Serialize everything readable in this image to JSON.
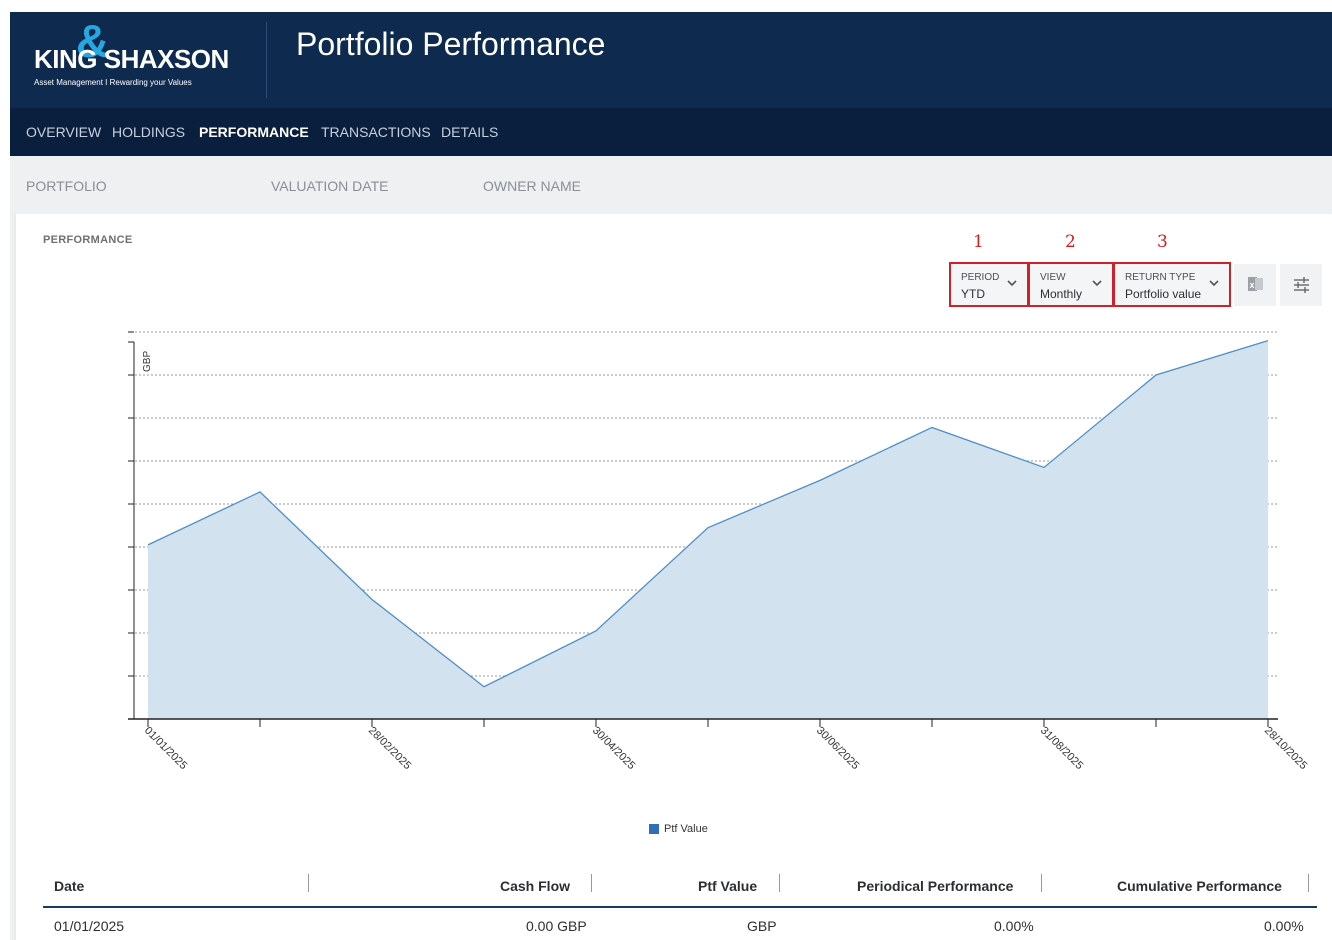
{
  "brand": {
    "logo_word": "KING SHAXSON",
    "logo_amp": "&",
    "tagline": "Asset Management I Rewarding your Values"
  },
  "header": {
    "title": "Portfolio Performance"
  },
  "nav": {
    "items": [
      {
        "label": "OVERVIEW",
        "active": false
      },
      {
        "label": "HOLDINGS",
        "active": false
      },
      {
        "label": "PERFORMANCE",
        "active": true
      },
      {
        "label": "TRANSACTIONS",
        "active": false
      },
      {
        "label": "DETAILS",
        "active": false
      }
    ]
  },
  "meta": {
    "portfolio_label": "PORTFOLIO",
    "valuation_date_label": "VALUATION DATE",
    "owner_name_label": "OWNER NAME"
  },
  "performance": {
    "section_title": "PERFORMANCE",
    "annotations": [
      "1",
      "2",
      "3"
    ],
    "controls": {
      "period": {
        "label": "PERIOD",
        "value": "YTD"
      },
      "view": {
        "label": "VIEW",
        "value": "Monthly"
      },
      "return_type": {
        "label": "RETURN TYPE",
        "value": "Portfolio value"
      }
    },
    "icons": {
      "export": "excel-export-icon",
      "settings": "sliders-settings-icon"
    },
    "colors": {
      "annotation_red": "#d0212b",
      "header_navy": "#0f2a4f",
      "area_fill": "#d2e2ef",
      "line": "#4f8fc6",
      "legend": "#2e6fb5"
    }
  },
  "chart_data": {
    "type": "area",
    "ylabel": "GBP",
    "x": [
      "01/01/2025",
      "31/01/2025",
      "28/02/2025",
      "31/03/2025",
      "30/04/2025",
      "31/05/2025",
      "30/06/2025",
      "31/07/2025",
      "31/08/2025",
      "30/09/2025",
      "28/10/2025"
    ],
    "x_tick_labels": [
      "01/01/2025",
      "28/02/2025",
      "30/04/2025",
      "30/06/2025",
      "31/08/2025",
      "28/10/2025"
    ],
    "series": [
      {
        "name": "Ptf Value",
        "values": [
          4.05,
          5.28,
          2.78,
          0.75,
          2.05,
          4.45,
          5.55,
          6.78,
          5.85,
          8.0,
          8.8
        ]
      }
    ],
    "ylim": [
      0,
      9
    ],
    "y_gridlines": 9,
    "grid": true,
    "legend_position": "bottom-center",
    "y_tick_labels_shown": false
  },
  "table": {
    "columns": [
      "Date",
      "Cash Flow",
      "Ptf Value",
      "Periodical Performance",
      "Cumulative Performance"
    ],
    "rows": [
      {
        "date": "01/01/2025",
        "cash_flow": "0.00 GBP",
        "ptf_value": "GBP",
        "periodical": "0.00%",
        "cumulative": "0.00%"
      }
    ]
  }
}
